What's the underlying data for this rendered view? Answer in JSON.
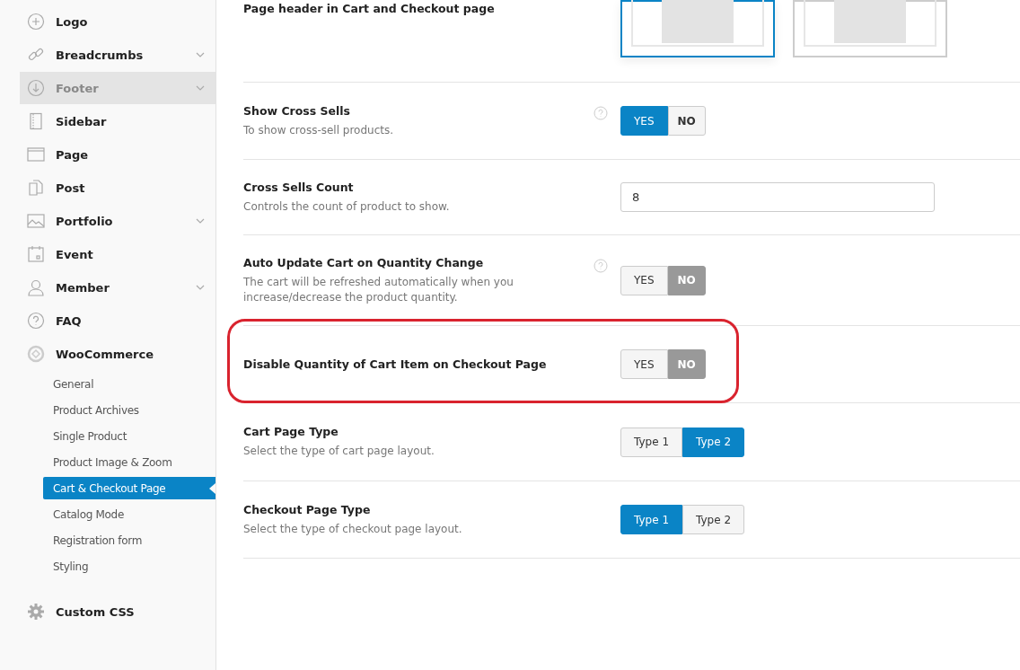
{
  "sidebar": {
    "items": [
      {
        "label": "Logo",
        "chevron": false,
        "highlighted": false
      },
      {
        "label": "Breadcrumbs",
        "chevron": true,
        "highlighted": false
      },
      {
        "label": "Footer",
        "chevron": true,
        "highlighted": true
      },
      {
        "label": "Sidebar",
        "chevron": false,
        "highlighted": false
      },
      {
        "label": "Page",
        "chevron": false,
        "highlighted": false
      },
      {
        "label": "Post",
        "chevron": false,
        "highlighted": false
      },
      {
        "label": "Portfolio",
        "chevron": true,
        "highlighted": false
      },
      {
        "label": "Event",
        "chevron": false,
        "highlighted": false
      },
      {
        "label": "Member",
        "chevron": true,
        "highlighted": false
      },
      {
        "label": "FAQ",
        "chevron": false,
        "highlighted": false
      },
      {
        "label": "WooCommerce",
        "chevron": false,
        "highlighted": false,
        "children": [
          {
            "label": "General",
            "selected": false
          },
          {
            "label": "Product Archives",
            "selected": false
          },
          {
            "label": "Single Product",
            "selected": false
          },
          {
            "label": "Product Image & Zoom",
            "selected": false
          },
          {
            "label": "Cart & Checkout Page",
            "selected": true
          },
          {
            "label": "Catalog Mode",
            "selected": false
          },
          {
            "label": "Registration form",
            "selected": false
          },
          {
            "label": "Styling",
            "selected": false
          }
        ]
      },
      {
        "label": "Custom CSS",
        "chevron": false,
        "highlighted": false
      }
    ]
  },
  "settings": [
    {
      "kind": "layout",
      "title": "Page header in Cart and Checkout page",
      "options": [
        {
          "selected": true
        },
        {
          "selected": false
        }
      ]
    },
    {
      "kind": "toggle",
      "title": "Show Cross Sells",
      "description": "To show cross-sell products.",
      "help": true,
      "annotated": false,
      "options": [
        {
          "label": "YES",
          "selected": true
        },
        {
          "label": "NO",
          "selected": false
        }
      ]
    },
    {
      "kind": "number",
      "title": "Cross Sells Count",
      "description": "Controls the count of product to show.",
      "value": "8"
    },
    {
      "kind": "toggle",
      "title": "Auto Update Cart on Quantity Change",
      "description": "The cart will be refreshed automatically when you increase/decrease the product quantity.",
      "help": true,
      "annotated": false,
      "options": [
        {
          "label": "YES",
          "selected": false
        },
        {
          "label": "NO",
          "selected": true
        }
      ]
    },
    {
      "kind": "toggle",
      "title": "Disable Quantity of Cart Item on Checkout Page",
      "help": false,
      "annotated": true,
      "options": [
        {
          "label": "YES",
          "selected": false
        },
        {
          "label": "NO",
          "selected": true
        }
      ]
    },
    {
      "kind": "choice",
      "title": "Cart Page Type",
      "description": "Select the type of cart page layout.",
      "options": [
        {
          "label": "Type 1",
          "selected": false
        },
        {
          "label": "Type 2",
          "selected": true
        }
      ]
    },
    {
      "kind": "choice",
      "title": "Checkout Page Type",
      "description": "Select the type of checkout page layout.",
      "options": [
        {
          "label": "Type 1",
          "selected": true
        },
        {
          "label": "Type 2",
          "selected": false
        }
      ]
    }
  ]
}
